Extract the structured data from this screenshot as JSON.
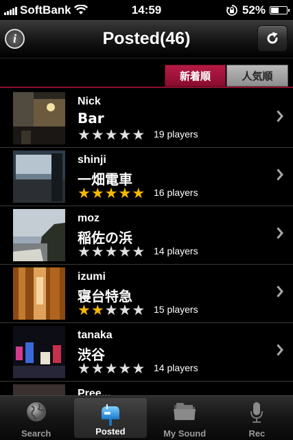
{
  "status": {
    "carrier": "SoftBank",
    "time": "14:59",
    "battery_text": "52%",
    "battery_level": 0.52
  },
  "nav": {
    "title": "Posted(46)",
    "info_icon": "info-icon",
    "refresh_icon": "refresh-icon"
  },
  "sort": {
    "newest_label": "新着順",
    "popular_label": "人気順",
    "selected": "newest"
  },
  "items": [
    {
      "user": "Nick",
      "title": "Bar",
      "rating": 0,
      "players": "19 players"
    },
    {
      "user": "shinji",
      "title": "一畑電車",
      "rating": 5,
      "players": "16 players"
    },
    {
      "user": "moz",
      "title": "稲佐の浜",
      "rating": 0,
      "players": "14 players"
    },
    {
      "user": "izumi",
      "title": "寝台特急",
      "rating": 2,
      "players": "15 players"
    },
    {
      "user": "tanaka",
      "title": "渋谷",
      "rating": 0,
      "players": "14 players"
    },
    {
      "user": "Pree... ",
      "title": "",
      "rating": 0,
      "players": ""
    }
  ],
  "tabs": {
    "search": "Search",
    "posted": "Posted",
    "my_sound": "My Sound",
    "rec": "Rec",
    "active": "posted"
  },
  "colors": {
    "accent": "#8c1030",
    "star_on": "#f7b800",
    "star_off": "#e0e0e0"
  }
}
